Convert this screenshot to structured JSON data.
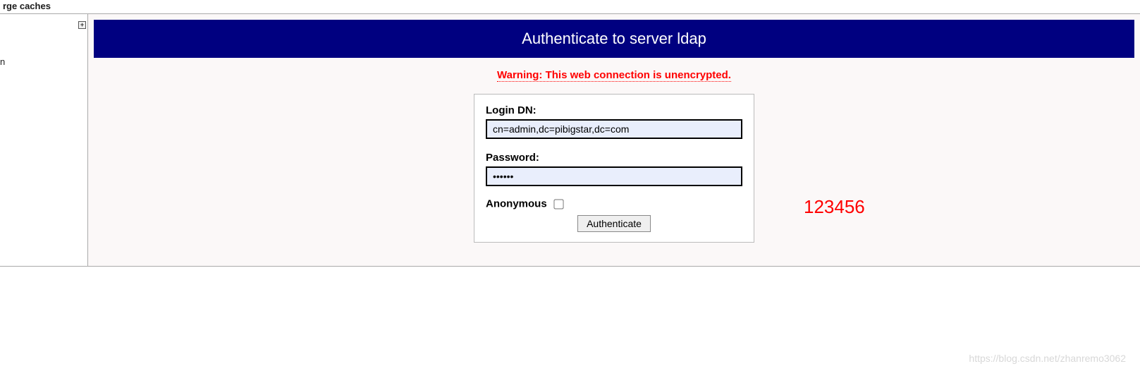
{
  "topbar": {
    "partial_link": "rge caches"
  },
  "sidebar": {
    "partial_text": "n",
    "expand_glyph": "+"
  },
  "header": {
    "title": "Authenticate to server ldap"
  },
  "warning": {
    "text": "Warning: This web connection is unencrypted."
  },
  "form": {
    "login_dn_label": "Login DN:",
    "login_dn_value": "cn=admin,dc=pibigstar,dc=com",
    "password_label": "Password:",
    "password_value": "123456",
    "anonymous_label": "Anonymous",
    "anonymous_checked": false,
    "submit_label": "Authenticate"
  },
  "annotation": {
    "text": "123456"
  },
  "watermark": {
    "text": "https://blog.csdn.net/zhanremo3062"
  }
}
